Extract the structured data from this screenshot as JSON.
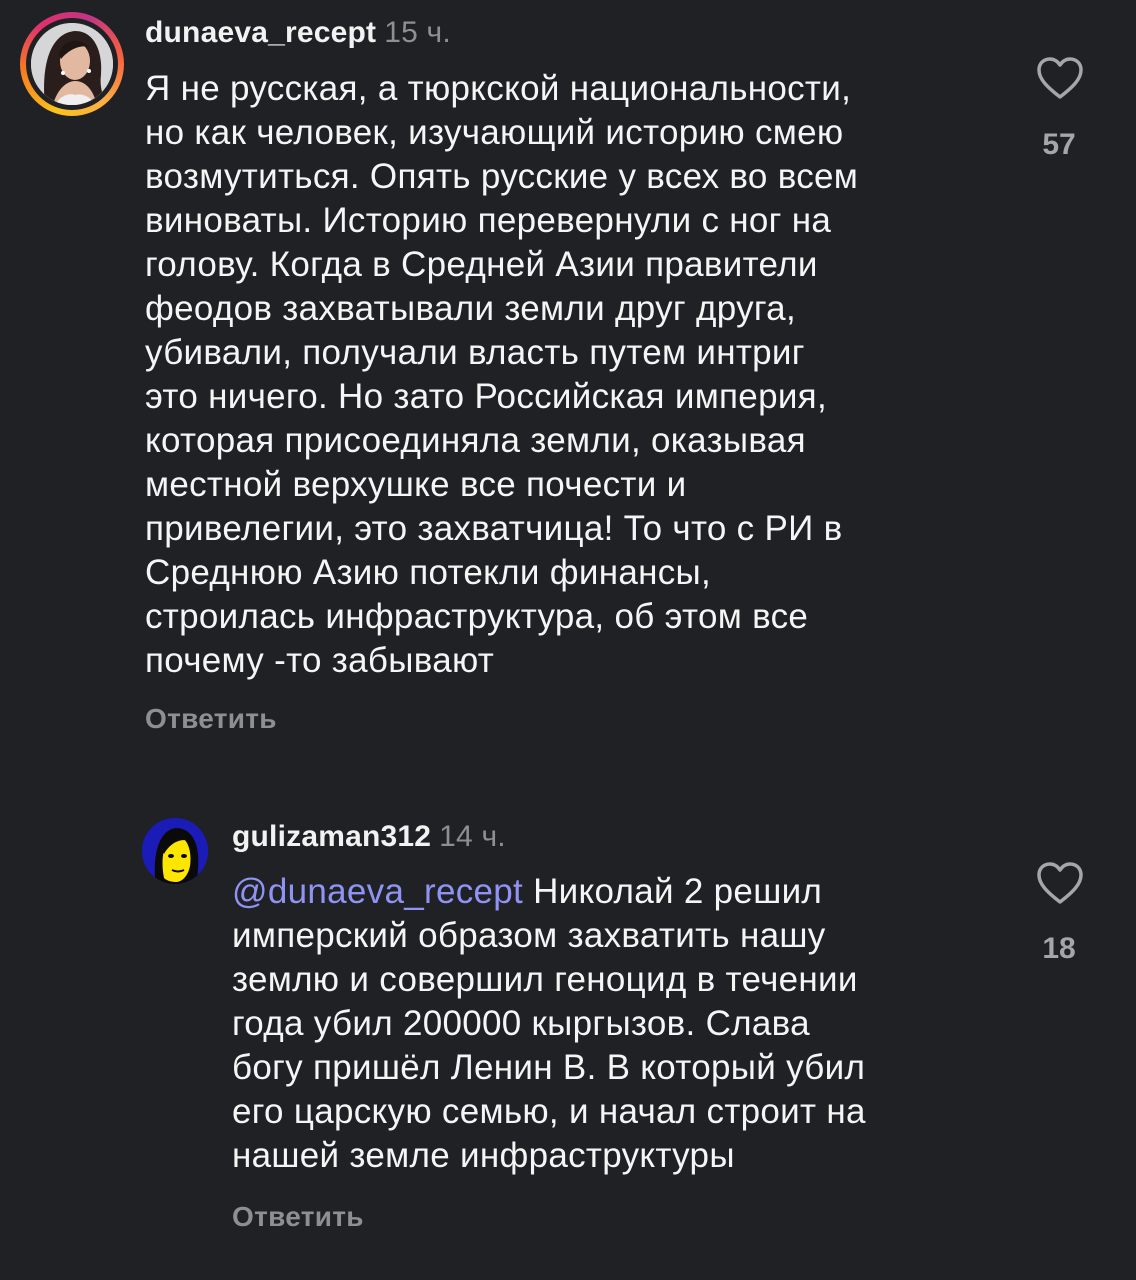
{
  "comments": [
    {
      "username": "dunaeva_recept",
      "time": "15 ч.",
      "text": "Я не русская, а тюркской национальности,\nно как человек, изучающий историю смею\nвозмутиться. Опять русские у всех во всем\nвиноваты. Историю перевернули с ног на\nголову. Когда в Средней Азии правители\nфеодов захватывали земли друг друга,\nубивали, получали власть путем интриг\nэто ничего. Но зато  Российская империя,\nкоторая присоединяла земли, оказывая\nместной верхушке все почести и\nпривелегии, это захватчица! То что с РИ в\nСреднюю Азию потекли финансы,\nстроилась инфраструктура, об этом все\nпочему -то забывают",
      "reply_label": "Ответить",
      "likes": "57"
    },
    {
      "username": "gulizaman312",
      "time": "14 ч.",
      "mention": "@dunaeva_recept",
      "text": " Николай 2 решил\nимперский образом захватить нашу\nземлю и совершил геноцид в течении\nгода убил 200000 кыргызов. Слава\nбогу пришёл Ленин В. В который убил\nего царскую семью, и начал строит на\nнашей земле инфраструктуры",
      "reply_label": "Ответить",
      "likes": "18"
    }
  ],
  "icons": {
    "like": "heart-outline-icon"
  },
  "colors": {
    "background": "#202125",
    "text": "#f5f5f5",
    "secondary": "#8e8e93",
    "mention": "#8f94f4",
    "avatar2_bg": "#1b1bb8",
    "avatar2_face": "#ffe600"
  }
}
